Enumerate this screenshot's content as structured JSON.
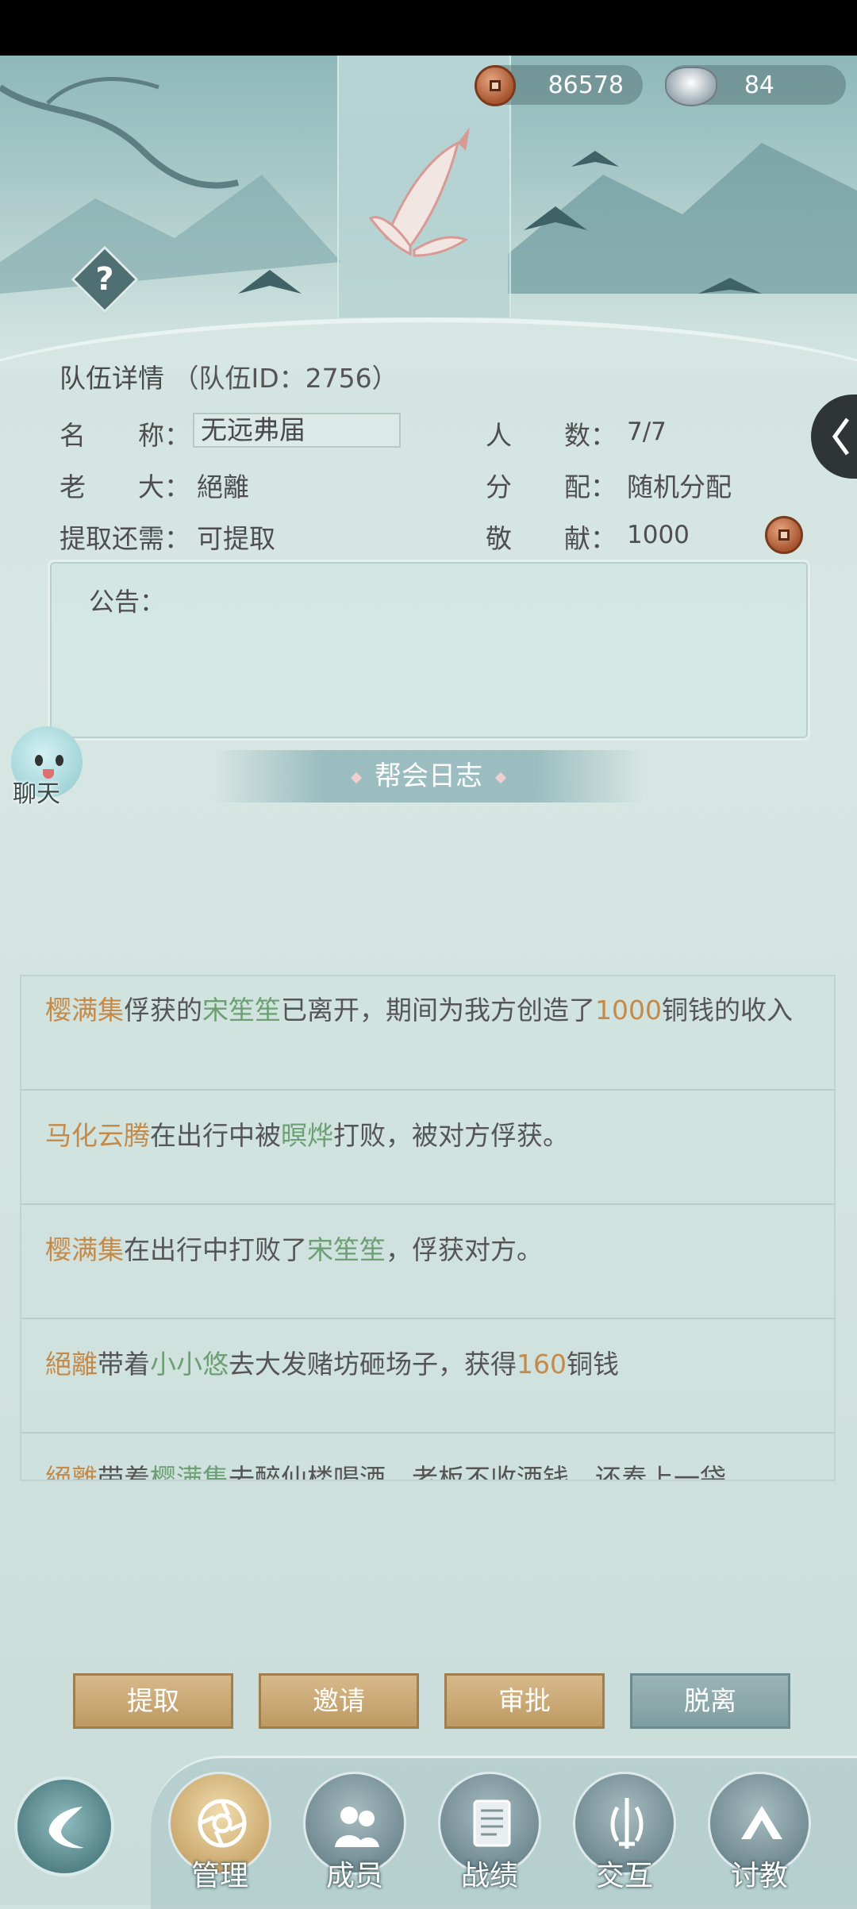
{
  "currency": {
    "coins": "86578",
    "silver": "84"
  },
  "team": {
    "title": "队伍详情",
    "id_text": "（队伍ID：2756）",
    "name_label": "名　　称：",
    "name_value": "无远弗届",
    "count_label": "人　　数：",
    "count_value": "7/7",
    "boss_label": "老　　大：",
    "boss_value": "絕離",
    "dist_label": "分　　配：",
    "dist_value": "随机分配",
    "withdraw_label": "提取还需：",
    "withdraw_value": "可提取",
    "contrib_label": "敬　　献：",
    "contrib_value": "1000"
  },
  "notice": {
    "label": "公告："
  },
  "chat": {
    "label": "聊天"
  },
  "log": {
    "title": "帮会日志",
    "items": [
      {
        "parts": [
          {
            "t": "樱满集",
            "c": "name"
          },
          {
            "t": "俘获的"
          },
          {
            "t": "宋笙笙",
            "c": "green"
          },
          {
            "t": "已离开，期间为我方创造了"
          },
          {
            "t": "1000",
            "c": "num"
          },
          {
            "t": "铜钱的收入"
          }
        ]
      },
      {
        "parts": [
          {
            "t": "马化云腾",
            "c": "name"
          },
          {
            "t": "在出行中被"
          },
          {
            "t": "暝烨",
            "c": "green"
          },
          {
            "t": "打败，被对方俘获。"
          }
        ]
      },
      {
        "parts": [
          {
            "t": "樱满集",
            "c": "name"
          },
          {
            "t": "在出行中打败了"
          },
          {
            "t": "宋笙笙",
            "c": "green"
          },
          {
            "t": "，俘获对方。"
          }
        ]
      },
      {
        "parts": [
          {
            "t": "絕離",
            "c": "name"
          },
          {
            "t": "带着"
          },
          {
            "t": "小小悠",
            "c": "green"
          },
          {
            "t": "去大发赌坊砸场子，获得"
          },
          {
            "t": "160",
            "c": "num"
          },
          {
            "t": "铜钱"
          }
        ]
      },
      {
        "parts": [
          {
            "t": "絕離",
            "c": "name"
          },
          {
            "t": "带着"
          },
          {
            "t": "樱满集",
            "c": "green"
          },
          {
            "t": "去醉仙楼喝酒，老板不收酒钱，还奉上一袋"
          }
        ]
      }
    ]
  },
  "actions": {
    "withdraw": "提取",
    "invite": "邀请",
    "approve": "审批",
    "leave": "脱离"
  },
  "nav": {
    "manage": "管理",
    "members": "成员",
    "record": "战绩",
    "interact": "交互",
    "challenge": "讨教"
  }
}
